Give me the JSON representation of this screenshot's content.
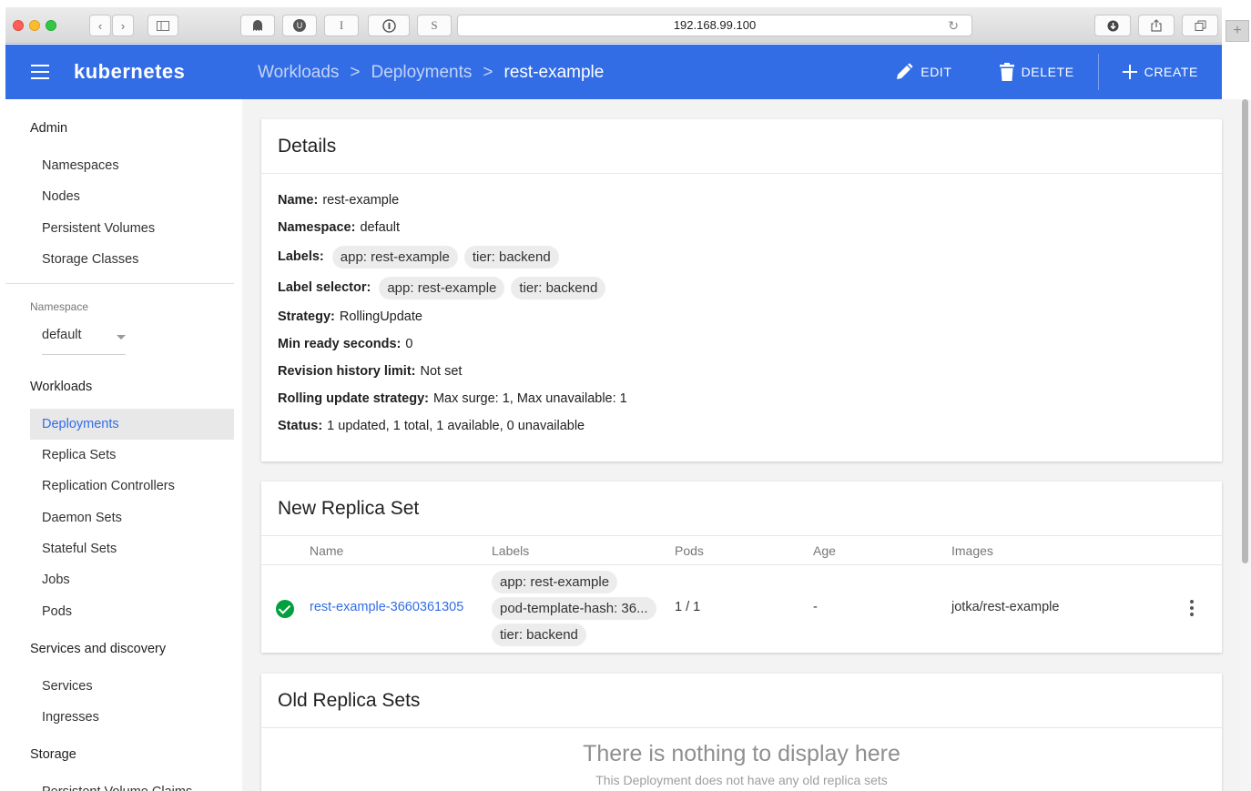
{
  "browser": {
    "url": "192.168.99.100",
    "toolbar_glyphs": [
      "U",
      "I",
      "S"
    ]
  },
  "appbar": {
    "brand": "kubernetes",
    "breadcrumbs": [
      "Workloads",
      "Deployments",
      "rest-example"
    ],
    "separator": ">",
    "actions": {
      "edit": "EDIT",
      "delete": "DELETE",
      "create": "CREATE"
    },
    "color": "#326de6"
  },
  "sidebar": {
    "admin_heading": "Admin",
    "admin_items": [
      "Namespaces",
      "Nodes",
      "Persistent Volumes",
      "Storage Classes"
    ],
    "namespace_label": "Namespace",
    "namespace_value": "default",
    "workloads_heading": "Workloads",
    "workload_items": [
      "Deployments",
      "Replica Sets",
      "Replication Controllers",
      "Daemon Sets",
      "Stateful Sets",
      "Jobs",
      "Pods"
    ],
    "active_item": "Deployments",
    "services_heading": "Services and discovery",
    "services_items": [
      "Services",
      "Ingresses"
    ],
    "storage_heading": "Storage",
    "storage_items": [
      "Persistent Volume Claims"
    ]
  },
  "details": {
    "title": "Details",
    "name_label": "Name:",
    "name_value": "rest-example",
    "namespace_label": "Namespace:",
    "namespace_value": "default",
    "labels_label": "Labels:",
    "labels": [
      "app: rest-example",
      "tier: backend"
    ],
    "selector_label": "Label selector:",
    "selector": [
      "app: rest-example",
      "tier: backend"
    ],
    "strategy_label": "Strategy:",
    "strategy_value": "RollingUpdate",
    "min_ready_label": "Min ready seconds:",
    "min_ready_value": "0",
    "revision_label": "Revision history limit:",
    "revision_value": "Not set",
    "rolling_label": "Rolling update strategy:",
    "rolling_value": "Max surge: 1, Max unavailable: 1",
    "status_label": "Status:",
    "status_value": "1 updated, 1 total, 1 available, 0 unavailable"
  },
  "new_replica_set": {
    "title": "New Replica Set",
    "columns": [
      "Name",
      "Labels",
      "Pods",
      "Age",
      "Images"
    ],
    "row": {
      "status_icon": "check-circle-icon",
      "name": "rest-example-3660361305",
      "labels": [
        "app: rest-example",
        "pod-template-hash: 36...",
        "tier: backend"
      ],
      "pods": "1 / 1",
      "age": "-",
      "images": "jotka/rest-example"
    }
  },
  "old_replica_sets": {
    "title": "Old Replica Sets",
    "empty_title": "There is nothing to display here",
    "empty_subtitle": "This Deployment does not have any old replica sets"
  }
}
